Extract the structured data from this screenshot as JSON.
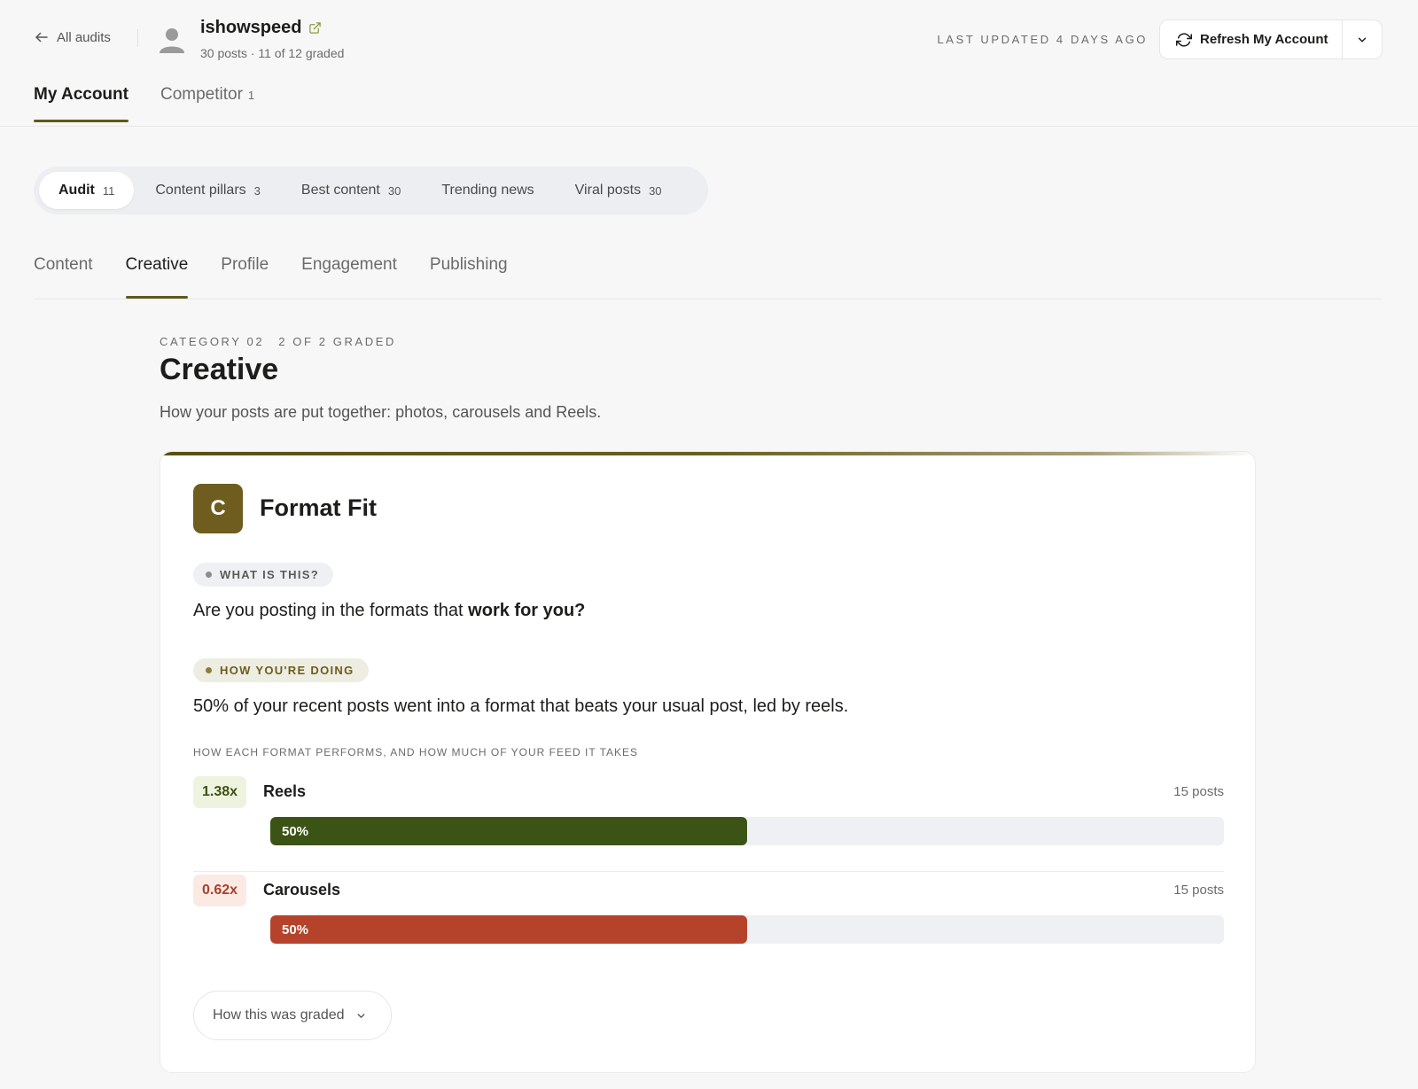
{
  "header": {
    "back_label": "All audits",
    "account_name": "ishowspeed",
    "account_meta": "30 posts · 11 of 12 graded",
    "last_updated": "LAST UPDATED 4 DAYS AGO",
    "refresh_label": "Refresh My Account"
  },
  "account_tabs": [
    {
      "label": "My Account",
      "count": "",
      "active": true
    },
    {
      "label": "Competitor",
      "count": "1",
      "active": false
    }
  ],
  "pills": [
    {
      "label": "Audit",
      "count": "11",
      "active": true
    },
    {
      "label": "Content pillars",
      "count": "3",
      "active": false
    },
    {
      "label": "Best content",
      "count": "30",
      "active": false
    },
    {
      "label": "Trending news",
      "count": "",
      "active": false
    },
    {
      "label": "Viral posts",
      "count": "30",
      "active": false
    }
  ],
  "subtabs": [
    {
      "label": "Content",
      "active": false
    },
    {
      "label": "Creative",
      "active": true
    },
    {
      "label": "Profile",
      "active": false
    },
    {
      "label": "Engagement",
      "active": false
    },
    {
      "label": "Publishing",
      "active": false
    }
  ],
  "category": {
    "kicker": "CATEGORY 02",
    "graded": "2 OF 2 GRADED",
    "title": "Creative",
    "description": "How your posts are put together: photos, carousels and Reels."
  },
  "card": {
    "grade": "C",
    "title": "Format Fit",
    "what_chip": "WHAT IS THIS?",
    "question_pre": "Are you posting in the formats that ",
    "question_bold": "work for you?",
    "how_chip": "HOW YOU'RE DOING",
    "summary": "50% of your recent posts went into a format that beats your usual post, led by reels.",
    "table_caption": "HOW EACH FORMAT PERFORMS, AND HOW MUCH OF YOUR FEED IT TAKES",
    "formats": [
      {
        "multiplier": "1.38x",
        "name": "Reels",
        "posts": "15 posts",
        "share_label": "50%",
        "share": 50,
        "tone": "good"
      },
      {
        "multiplier": "0.62x",
        "name": "Carousels",
        "posts": "15 posts",
        "share_label": "50%",
        "share": 50,
        "tone": "bad"
      }
    ],
    "graded_button": "How this was graded"
  },
  "colors": {
    "accent": "#5d5a1c",
    "grade_box": "#6e5d1f",
    "good_bar": "#3b5415",
    "bad_bar": "#b5432b"
  },
  "icons": {
    "back": "arrow-left-icon",
    "avatar": "user-avatar-icon",
    "external": "external-link-icon",
    "refresh": "refresh-icon",
    "caret": "chevron-down-icon"
  }
}
